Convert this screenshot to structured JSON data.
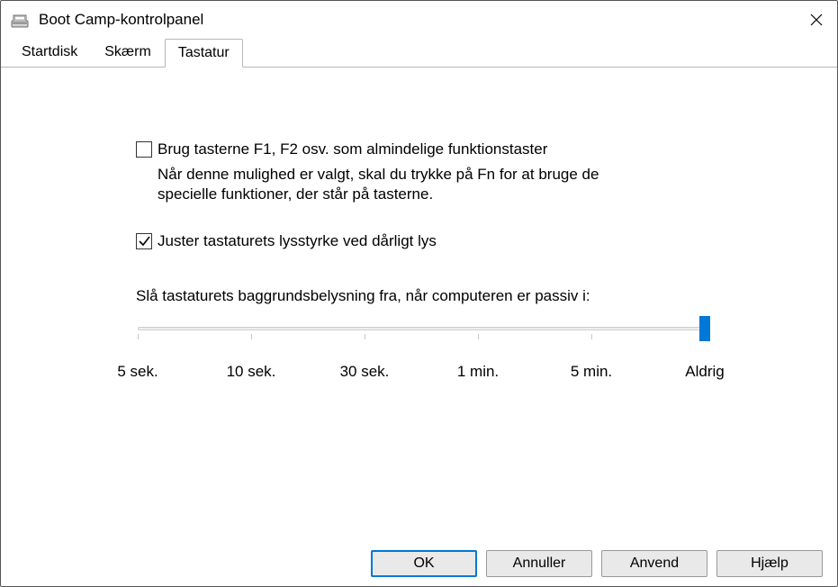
{
  "window": {
    "title": "Boot Camp-kontrolpanel"
  },
  "tabs": [
    {
      "label": "Startdisk"
    },
    {
      "label": "Skærm"
    },
    {
      "label": "Tastatur"
    }
  ],
  "activeTab": 2,
  "options": {
    "fnKeys": {
      "label": "Brug tasterne F1, F2 osv. som almindelige funktionstaster",
      "desc": "Når denne mulighed er valgt, skal du trykke på Fn for at bruge de specielle funktioner, der står på tasterne.",
      "checked": false
    },
    "autoBrightness": {
      "label": "Juster tastaturets lysstyrke ved dårligt lys",
      "checked": true
    }
  },
  "backlight": {
    "label": "Slå tastaturets baggrundsbelysning fra, når computeren er passiv i:",
    "stops": [
      "5 sek.",
      "10 sek.",
      "30 sek.",
      "1 min.",
      "5 min.",
      "Aldrig"
    ],
    "valueIndex": 5
  },
  "buttons": {
    "ok": "OK",
    "cancel": "Annuller",
    "apply": "Anvend",
    "help": "Hjælp"
  }
}
